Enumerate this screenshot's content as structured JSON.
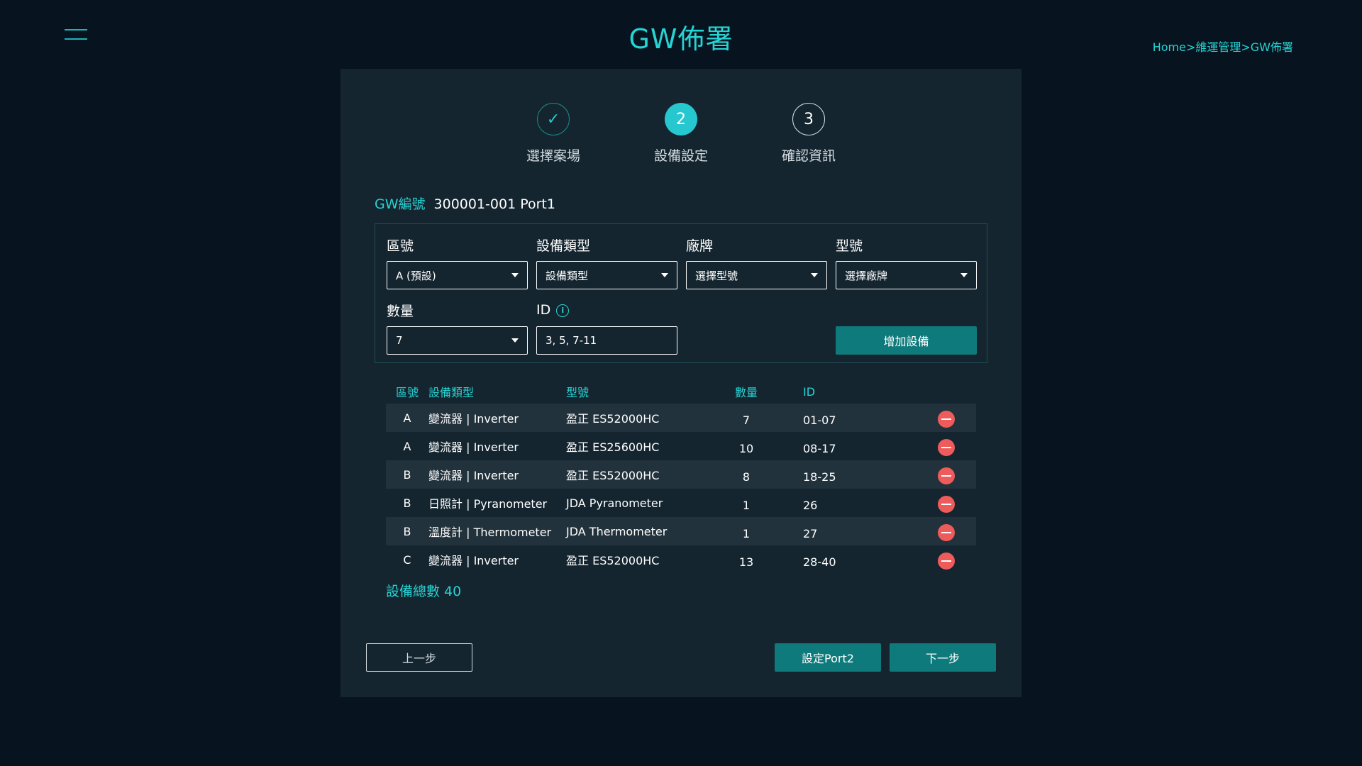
{
  "header": {
    "title": "GW佈署",
    "breadcrumb": "Home>維運管理>GW佈署"
  },
  "steps": [
    {
      "icon": "✓",
      "label": "選擇案場"
    },
    {
      "icon": "2",
      "label": "設備設定"
    },
    {
      "icon": "3",
      "label": "確認資訊"
    }
  ],
  "gw": {
    "label": "GW編號",
    "value": "300001-001 Port1"
  },
  "form": {
    "zone": {
      "label": "區號",
      "value": "A (預設)"
    },
    "device_type": {
      "label": "設備類型",
      "value": "設備類型"
    },
    "brand": {
      "label": "廠牌",
      "value": "選擇型號"
    },
    "model": {
      "label": "型號",
      "value": "選擇廠牌"
    },
    "quantity": {
      "label": "數量",
      "value": "7"
    },
    "id": {
      "label": "ID",
      "value": "3, 5, 7-11"
    },
    "add_button": "增加設備"
  },
  "table": {
    "headers": {
      "zone": "區號",
      "type": "設備類型",
      "model": "型號",
      "qty": "數量",
      "id": "ID"
    },
    "rows": [
      {
        "zone": "A",
        "type": "變流器 | Inverter",
        "model": "盈正 ES52000HC",
        "qty": "7",
        "id": "01-07"
      },
      {
        "zone": "A",
        "type": "變流器 | Inverter",
        "model": "盈正 ES25600HC",
        "qty": "10",
        "id": "08-17"
      },
      {
        "zone": "B",
        "type": "變流器 | Inverter",
        "model": "盈正 ES52000HC",
        "qty": "8",
        "id": "18-25"
      },
      {
        "zone": "B",
        "type": "日照計 | Pyranometer",
        "model": "JDA Pyranometer",
        "qty": "1",
        "id": "26"
      },
      {
        "zone": "B",
        "type": "溫度計 | Thermometer",
        "model": "JDA Thermometer",
        "qty": "1",
        "id": "27"
      },
      {
        "zone": "C",
        "type": "變流器 | Inverter",
        "model": "盈正 ES52000HC",
        "qty": "13",
        "id": "28-40"
      }
    ]
  },
  "total": "設備總數 40",
  "buttons": {
    "prev": "上一步",
    "port2": "設定Port2",
    "next": "下一步"
  },
  "colors": {
    "accent": "#27d3d3",
    "button": "#0f7a7b",
    "remove": "#ee5b5b",
    "background": "#07141f",
    "panel": "#14252f"
  }
}
